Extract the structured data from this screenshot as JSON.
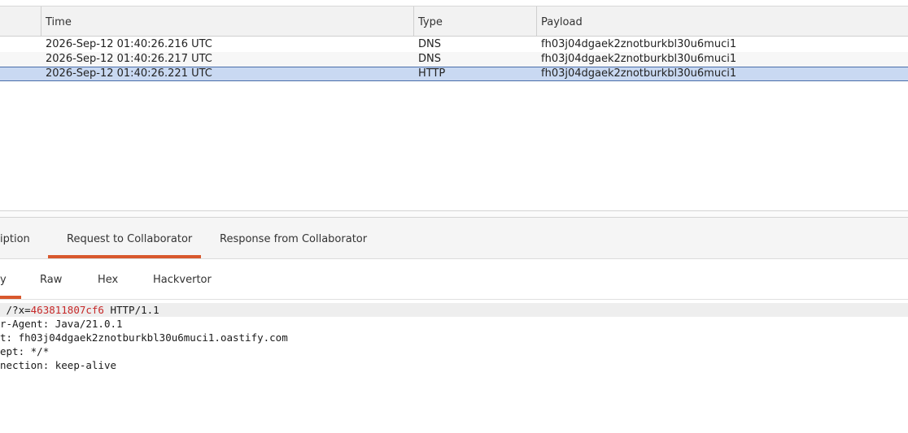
{
  "table": {
    "columns": [
      "Time",
      "Type",
      "Payload"
    ],
    "rows": [
      {
        "time": "2026-Sep-12 01:40:26.216 UTC",
        "type": "DNS",
        "payload": "fh03j04dgaek2znotburkbl30u6muci1"
      },
      {
        "time": "2026-Sep-12 01:40:26.217 UTC",
        "type": "DNS",
        "payload": "fh03j04dgaek2znotburkbl30u6muci1"
      },
      {
        "time": "2026-Sep-12 01:40:26.221 UTC",
        "type": "HTTP",
        "payload": "fh03j04dgaek2znotburkbl30u6muci1"
      }
    ],
    "selected_row": 2
  },
  "detail_tabs": [
    {
      "label": "iption"
    },
    {
      "label": "Request to Collaborator"
    },
    {
      "label": "Response from Collaborator"
    }
  ],
  "detail_tabs_selected": 1,
  "view_tabs": [
    {
      "label": "y"
    },
    {
      "label": "Raw"
    },
    {
      "label": "Hex"
    },
    {
      "label": "Hackvertor"
    }
  ],
  "view_tabs_selected": 0,
  "request": {
    "line0": {
      "prefix": " /?",
      "param": "x",
      "eq": "=",
      "value": "463811807cf6",
      "suffix": " HTTP/1.1"
    },
    "headers": [
      {
        "name": "r-Agent",
        "sep": ": ",
        "value": "Java/21.0.1"
      },
      {
        "name": "t",
        "sep": ": ",
        "value": "fh03j04dgaek2znotburkbl30u6muci1.oastify.com"
      },
      {
        "name": "ept",
        "sep": ": ",
        "value": "*/*"
      },
      {
        "name": "nection",
        "sep": ": ",
        "value": "keep-alive"
      }
    ]
  },
  "colors": {
    "accent": "#d8582d",
    "selected_row": "#c9d9f2",
    "param_value": "#c62828"
  }
}
